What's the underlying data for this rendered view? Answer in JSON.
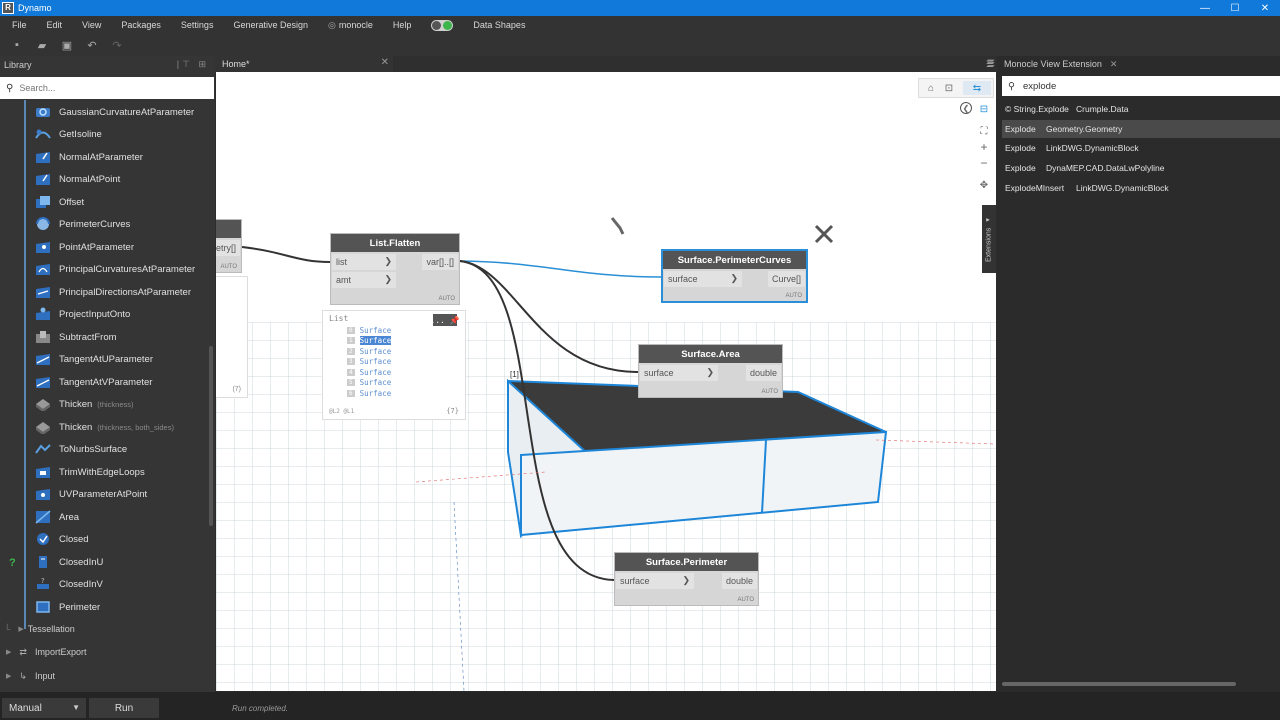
{
  "app": {
    "title": "Dynamo"
  },
  "menu": [
    "File",
    "Edit",
    "View",
    "Packages",
    "Settings",
    "Generative Design",
    "monocle",
    "Help",
    "",
    "Data Shapes"
  ],
  "library": {
    "title": "Library",
    "search_placeholder": "Search...",
    "items": [
      {
        "label": "GaussianCurvatureAtParameter",
        "hint": "",
        "icon": "curvature-icon"
      },
      {
        "label": "GetIsoline",
        "hint": "",
        "icon": "isoline-icon"
      },
      {
        "label": "NormalAtParameter",
        "hint": "",
        "icon": "normal-icon"
      },
      {
        "label": "NormalAtPoint",
        "hint": "",
        "icon": "normal-icon"
      },
      {
        "label": "Offset",
        "hint": "",
        "icon": "offset-icon"
      },
      {
        "label": "PerimeterCurves",
        "hint": "",
        "icon": "perimeter-curves-icon"
      },
      {
        "label": "PointAtParameter",
        "hint": "",
        "icon": "point-icon"
      },
      {
        "label": "PrincipalCurvaturesAtParameter",
        "hint": "",
        "icon": "curvature-icon"
      },
      {
        "label": "PrincipalDirectionsAtParameter",
        "hint": "",
        "icon": "direction-icon"
      },
      {
        "label": "ProjectInputOnto",
        "hint": "",
        "icon": "project-icon"
      },
      {
        "label": "SubtractFrom",
        "hint": "",
        "icon": "subtract-icon"
      },
      {
        "label": "TangentAtUParameter",
        "hint": "",
        "icon": "tangent-icon"
      },
      {
        "label": "TangentAtVParameter",
        "hint": "",
        "icon": "tangent-icon"
      },
      {
        "label": "Thicken",
        "hint": "(thickness)",
        "icon": "thicken-icon"
      },
      {
        "label": "Thicken",
        "hint": "(thickness, both_sides)",
        "icon": "thicken-icon"
      },
      {
        "label": "ToNurbsSurface",
        "hint": "",
        "icon": "nurbs-icon"
      },
      {
        "label": "TrimWithEdgeLoops",
        "hint": "",
        "icon": "trim-icon"
      },
      {
        "label": "UVParameterAtPoint",
        "hint": "",
        "icon": "uv-icon"
      },
      {
        "label": "Area",
        "hint": "",
        "icon": "area-icon"
      },
      {
        "label": "Closed",
        "hint": "",
        "icon": "closed-icon"
      },
      {
        "label": "ClosedInU",
        "hint": "",
        "icon": "closed-u-icon"
      },
      {
        "label": "ClosedInV",
        "hint": "",
        "icon": "closed-v-icon"
      },
      {
        "label": "Perimeter",
        "hint": "",
        "icon": "perimeter-icon"
      }
    ],
    "categories": [
      {
        "label": "Tessellation"
      },
      {
        "label": "ImportExport"
      },
      {
        "label": "Input"
      }
    ]
  },
  "workspace": {
    "tab_label": "Home*",
    "nodes": {
      "flatten": {
        "title": "List.Flatten",
        "in1": "list",
        "in2": "amt",
        "out": "var[]..[]",
        "auto": "AUTO"
      },
      "perimeter_curves": {
        "title": "Surface.PerimeterCurves",
        "in1": "surface",
        "out": "Curve[]",
        "auto": "AUTO"
      },
      "area": {
        "title": "Surface.Area",
        "in1": "surface",
        "out": "double",
        "auto": "AUTO"
      },
      "perimeter": {
        "title": "Surface.Perimeter",
        "in1": "surface",
        "out": "double",
        "auto": "AUTO"
      },
      "partial": {
        "out": "etry[]",
        "auto": "AUTO",
        "count": "(7)"
      }
    },
    "preview": {
      "header": "List",
      "button": "...",
      "rows": [
        {
          "index": "0",
          "value": "Surface"
        },
        {
          "index": "1",
          "value": "Surface"
        },
        {
          "index": "2",
          "value": "Surface"
        },
        {
          "index": "3",
          "value": "Surface"
        },
        {
          "index": "4",
          "value": "Surface"
        },
        {
          "index": "5",
          "value": "Surface"
        },
        {
          "index": "6",
          "value": "Surface"
        }
      ],
      "levels": "@L2 @L1",
      "count": "{7}"
    },
    "geometry_label": "[1]",
    "extensions_tab": "Extensions"
  },
  "monocle": {
    "title": "Monocle View Extension",
    "search_value": "explode",
    "results": [
      {
        "a": "© String.Explode",
        "b": "Crumple.Data"
      },
      {
        "a": "Explode",
        "b": "Geometry.Geometry"
      },
      {
        "a": "Explode",
        "b": "LinkDWG.DynamicBlock"
      },
      {
        "a": "Explode",
        "b": "DynaMEP.CAD.DataLwPolyline"
      },
      {
        "a": "ExplodeMInsert",
        "b": "LinkDWG.DynamicBlock"
      }
    ]
  },
  "status": {
    "run_mode": "Manual",
    "run_label": "Run",
    "message": "Run completed."
  },
  "colors": {
    "accent": "#1079d9",
    "selection": "#2a8fd6",
    "node_header": "#545454",
    "green": "#3cb64a"
  }
}
